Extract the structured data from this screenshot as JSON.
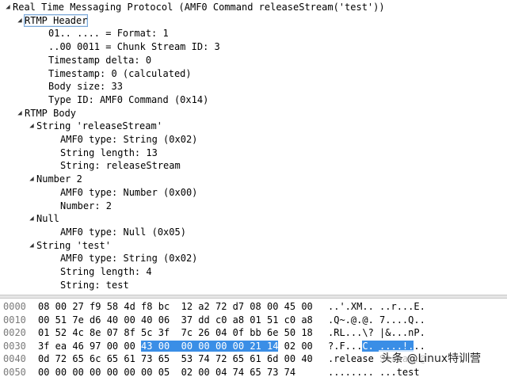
{
  "tree": [
    {
      "indent": 0,
      "toggle": "expanded",
      "text": "Real Time Messaging Protocol (AMF0 Command releaseStream('test'))"
    },
    {
      "indent": 1,
      "toggle": "expanded",
      "text": "RTMP Header",
      "selected": true
    },
    {
      "indent": 3,
      "toggle": "none",
      "text": "01.. .... = Format: 1"
    },
    {
      "indent": 3,
      "toggle": "none",
      "text": "..00 0011 = Chunk Stream ID: 3"
    },
    {
      "indent": 3,
      "toggle": "none",
      "text": "Timestamp delta: 0"
    },
    {
      "indent": 3,
      "toggle": "none",
      "text": "Timestamp: 0 (calculated)"
    },
    {
      "indent": 3,
      "toggle": "none",
      "text": "Body size: 33"
    },
    {
      "indent": 3,
      "toggle": "none",
      "text": "Type ID: AMF0 Command (0x14)"
    },
    {
      "indent": 1,
      "toggle": "expanded",
      "text": "RTMP Body"
    },
    {
      "indent": 2,
      "toggle": "expanded",
      "text": "String 'releaseStream'"
    },
    {
      "indent": 4,
      "toggle": "none",
      "text": "AMF0 type: String (0x02)"
    },
    {
      "indent": 4,
      "toggle": "none",
      "text": "String length: 13"
    },
    {
      "indent": 4,
      "toggle": "none",
      "text": "String: releaseStream"
    },
    {
      "indent": 2,
      "toggle": "expanded",
      "text": "Number 2"
    },
    {
      "indent": 4,
      "toggle": "none",
      "text": "AMF0 type: Number (0x00)"
    },
    {
      "indent": 4,
      "toggle": "none",
      "text": "Number: 2"
    },
    {
      "indent": 2,
      "toggle": "expanded",
      "text": "Null"
    },
    {
      "indent": 4,
      "toggle": "none",
      "text": "AMF0 type: Null (0x05)"
    },
    {
      "indent": 2,
      "toggle": "expanded",
      "text": "String 'test'"
    },
    {
      "indent": 4,
      "toggle": "none",
      "text": "AMF0 type: String (0x02)"
    },
    {
      "indent": 4,
      "toggle": "none",
      "text": "String length: 4"
    },
    {
      "indent": 4,
      "toggle": "none",
      "text": "String: test"
    }
  ],
  "hex": [
    {
      "offset": "0000",
      "bytes_pre": "08 00 27 f9 58 4d f8 bc  12 a2 72 d7 08 00 45 00",
      "bytes_hl": "",
      "bytes_post": "",
      "ascii_pre": "..'.XM.. ..r...E.",
      "ascii_hl": "",
      "ascii_post": ""
    },
    {
      "offset": "0010",
      "bytes_pre": "00 51 7e d6 40 00 40 06  37 dd c0 a8 01 51 c0 a8",
      "bytes_hl": "",
      "bytes_post": "",
      "ascii_pre": ".Q~.@.@. 7....Q..",
      "ascii_hl": "",
      "ascii_post": ""
    },
    {
      "offset": "0020",
      "bytes_pre": "01 52 4c 8e 07 8f 5c 3f  7c 26 04 0f bb 6e 50 18",
      "bytes_hl": "",
      "bytes_post": "",
      "ascii_pre": ".RL...\\? |&...nP.",
      "ascii_hl": "",
      "ascii_post": ""
    },
    {
      "offset": "0030",
      "bytes_pre": "3f ea 46 97 00 00 ",
      "bytes_hl": "43 00  00 00 00 00 21 14",
      "bytes_post": " 02 00",
      "ascii_pre": "?.F...",
      "ascii_hl": "C. ....!.",
      "ascii_post": ".."
    },
    {
      "offset": "0040",
      "bytes_pre": "0d 72 65 6c 65 61 73 65  53 74 72 65 61 6d 00 40",
      "bytes_hl": "",
      "bytes_post": "",
      "ascii_pre": ".release Stream.@",
      "ascii_hl": "",
      "ascii_post": ""
    },
    {
      "offset": "0050",
      "bytes_pre": "00 00 00 00 00 00 00 05  02 00 04 74 65 73 74",
      "bytes_hl": "",
      "bytes_post": "",
      "ascii_pre": "........ ...test",
      "ascii_hl": "",
      "ascii_post": ""
    }
  ],
  "watermark": "头条 @Linux特训营",
  "colors": {
    "selection_outline": "#7aa7d8",
    "highlight": "#3a8ee6",
    "offset_text": "#7a7a7a"
  }
}
